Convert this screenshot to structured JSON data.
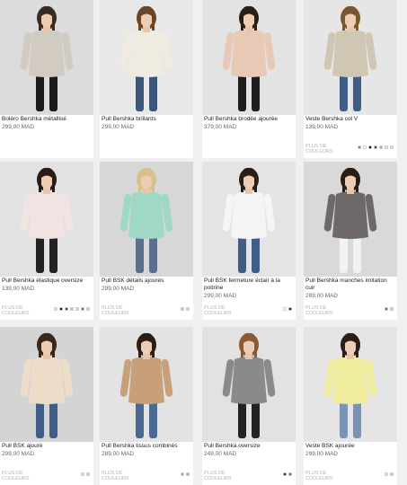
{
  "more_colors_label": "PLUS DE COULEURS",
  "products": [
    {
      "name": "Boléro Bershka métallisé",
      "price": "299,00 MAD",
      "bg": "#dcdcdc",
      "top": "#d2cbc2",
      "bottom": "#1a1a1a",
      "hair": "#3a2a1f",
      "colors": []
    },
    {
      "name": "Pull Bershka brillants",
      "price": "299,00 MAD",
      "bg": "#e8e8e8",
      "top": "#f0ebe1",
      "bottom": "#3c567b",
      "hair": "#6b4526",
      "colors": []
    },
    {
      "name": "Pull Bershka brodée ajourée",
      "price": "379,00 MAD",
      "bg": "#e3e3e3",
      "top": "#e7c9b6",
      "bottom": "#1e1e1e",
      "hair": "#2b1e16",
      "colors": []
    },
    {
      "name": "Veste Bershka col V",
      "price": "139,00 MAD",
      "bg": "#e6e6e6",
      "top": "#cfc6b3",
      "bottom": "#3f5d86",
      "hair": "#7a5530",
      "colors": [
        "#8a8a8a",
        "#ffffff",
        "#111111",
        "#2b3a6b",
        "#b89f7a",
        "#e9e2b8",
        "#f3ea7a"
      ]
    },
    {
      "name": "Pull Bershka élastique oversize",
      "price": "139,00 MAD",
      "bg": "#e2e2e2",
      "top": "#f2e3e3",
      "bottom": "#222222",
      "hair": "#2a1d15",
      "colors": [
        "#e9e9e9",
        "#111111",
        "#3b3b3b",
        "#bfbfbf",
        "#d9d9d9",
        "#6b6b6b",
        "#e6c9c9"
      ]
    },
    {
      "name": "Pull BSK détails ajourés",
      "price": "299,00 MAD",
      "bg": "#d7d7d7",
      "top": "#9fd8c5",
      "bottom": "#5a6f8e",
      "hair": "#d9c08a",
      "colors": [
        "#9fd8c5",
        "#cfcfcf"
      ]
    },
    {
      "name": "Pull BSK fermeture éclair à la poitrine",
      "price": "299,00 MAD",
      "bg": "#e4e4e4",
      "top": "#f5f5f5",
      "bottom": "#3f5d86",
      "hair": "#2b1e16",
      "colors": [
        "#ffffff",
        "#1a1a1a"
      ]
    },
    {
      "name": "Pull Bershka manches imitation cuir",
      "price": "289,00 MAD",
      "bg": "#d9d9d9",
      "top": "#6e6868",
      "bottom": "#f2f2f2",
      "hair": "#2b1e16",
      "colors": [
        "#6e6868",
        "#e9c1a8"
      ]
    },
    {
      "name": "Pull BSK ajouré",
      "price": "299,00 MAD",
      "bg": "#d4d4d4",
      "top": "#eddcc8",
      "bottom": "#3f5d86",
      "hair": "#3a271b",
      "colors": [
        "#eddcc8",
        "#f2c6a3"
      ]
    },
    {
      "name": "Pull Bershka tissus combinés",
      "price": "289,00 MAD",
      "bg": "#e3e3e3",
      "top": "#c7a07a",
      "bottom": "#4a6a92",
      "hair": "#2b1e16",
      "colors": [
        "#c7a07a",
        "#b9a9a9"
      ]
    },
    {
      "name": "Pull Bershka oversize",
      "price": "249,00 MAD",
      "bg": "#e2e2e2",
      "top": "#8a8a8a",
      "bottom": "#222222",
      "hair": "#8a5a35",
      "colors": [
        "#222222",
        "#b04a4a"
      ]
    },
    {
      "name": "Veste BSK ajourée",
      "price": "299,00 MAD",
      "bg": "#e5e5e5",
      "top": "#f0ec9e",
      "bottom": "#7a93b5",
      "hair": "#2b1e16",
      "colors": [
        "#f0ec9e",
        "#e8b6c4"
      ]
    }
  ]
}
